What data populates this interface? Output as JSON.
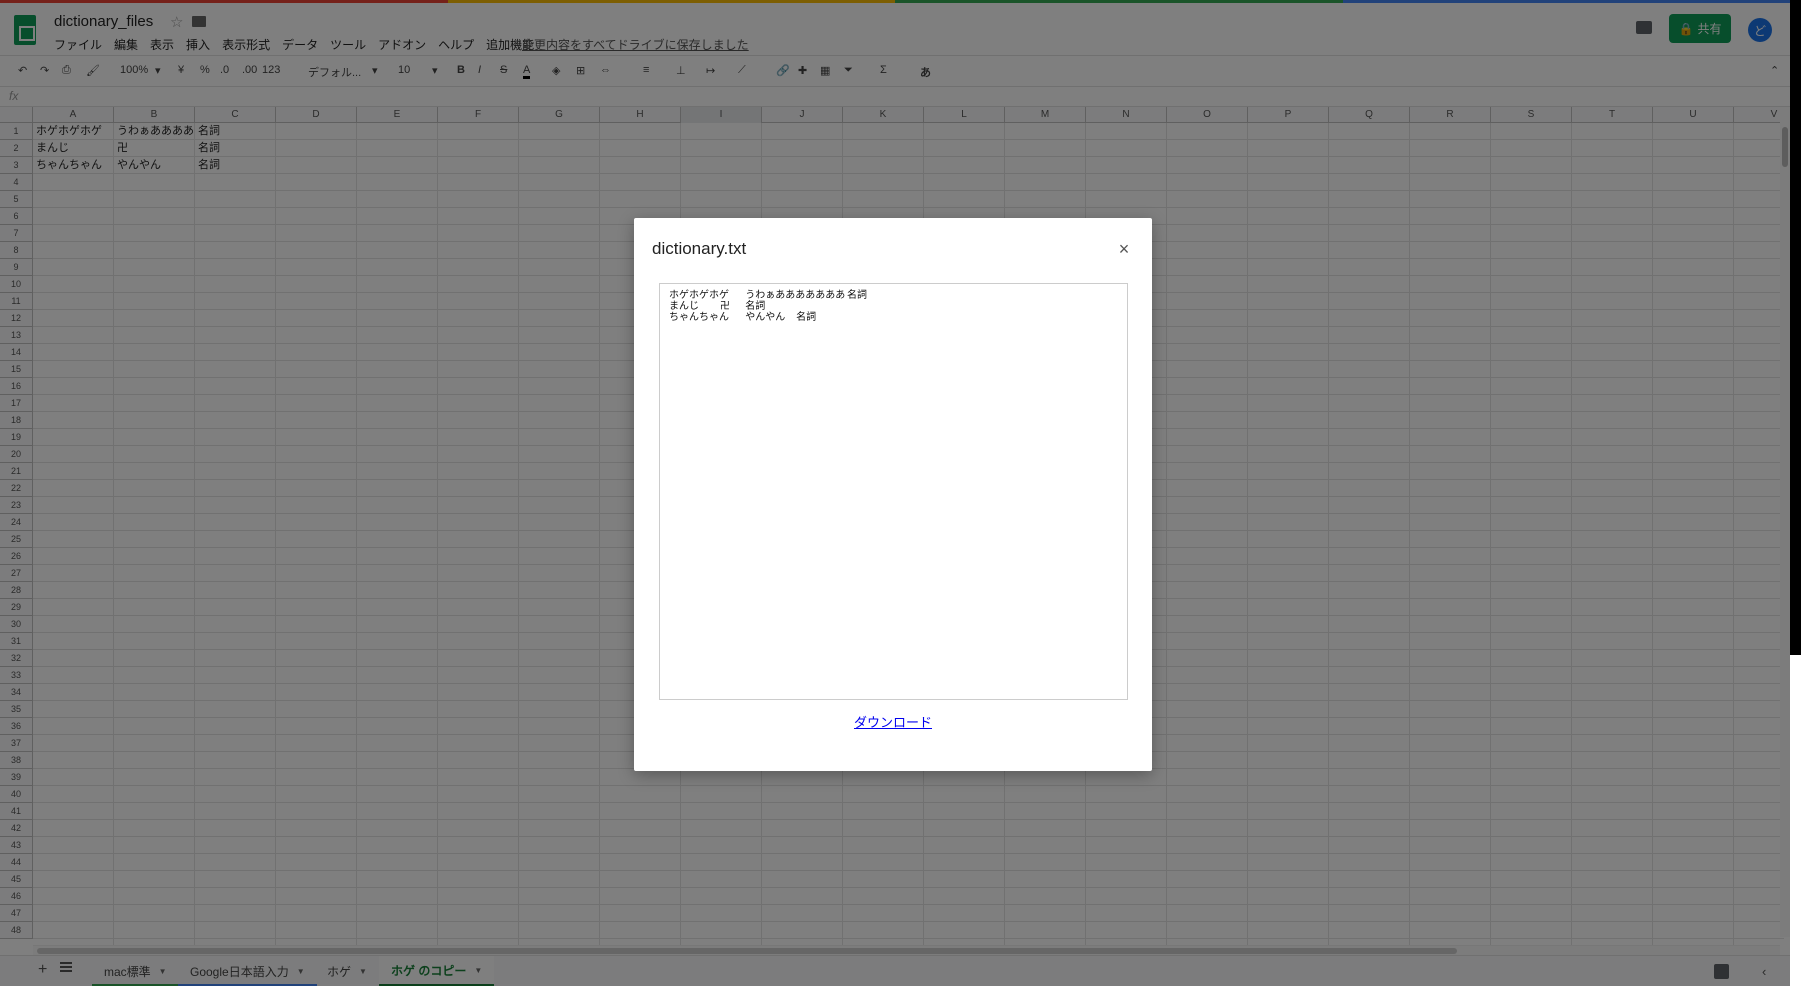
{
  "colors": {
    "strip": [
      "#ea4335",
      "#fbbc04",
      "#34a853",
      "#4285f4"
    ],
    "accent": "#0f9d58",
    "link": "#0000ee"
  },
  "doc": {
    "title": "dictionary_files",
    "saved_status": "変更内容をすべてドライブに保存しました"
  },
  "menu": [
    "ファイル",
    "編集",
    "表示",
    "挿入",
    "表示形式",
    "データ",
    "ツール",
    "アドオン",
    "ヘルプ",
    "追加機能"
  ],
  "share_label": "共有",
  "avatar_letter": "ど",
  "toolbar": {
    "zoom": "100%",
    "currency": "¥",
    "percent": "%",
    "dec_less": ".0",
    "dec_more": ".00",
    "format": "123",
    "font": "デフォル...",
    "font_size": "10",
    "bold": "B",
    "italic": "I",
    "strike": "S",
    "text_color": "A",
    "input_tool": "あ"
  },
  "formula_label": "fx",
  "columns": [
    "A",
    "B",
    "C",
    "D",
    "E",
    "F",
    "G",
    "H",
    "I",
    "J",
    "K",
    "L",
    "M",
    "N",
    "O",
    "P",
    "Q",
    "R",
    "S",
    "T",
    "U",
    "V"
  ],
  "selected_column": "I",
  "row_count": 48,
  "cells": [
    [
      "ホゲホゲホゲ",
      "うわぁあああああああ",
      "名詞"
    ],
    [
      "まんじ",
      "卍",
      "名詞"
    ],
    [
      "ちゃんちゃん",
      "やんやん",
      "名詞"
    ]
  ],
  "sheets": [
    {
      "name": "mac標準",
      "color": "#34a853",
      "active": false
    },
    {
      "name": "Google日本語入力",
      "color": "#4285f4",
      "active": false
    },
    {
      "name": "ホゲ",
      "color": "",
      "active": false
    },
    {
      "name": "ホゲ のコピー",
      "color": "#188038",
      "active": true
    }
  ],
  "modal": {
    "title": "dictionary.txt",
    "close_symbol": "×",
    "content": "ホゲホゲホゲ\tうわぁあああああああ\t名詞\nまんじ\t卍\t名詞\nちゃんちゃん\tやんやん\t名詞",
    "download_label": "ダウンロード"
  }
}
